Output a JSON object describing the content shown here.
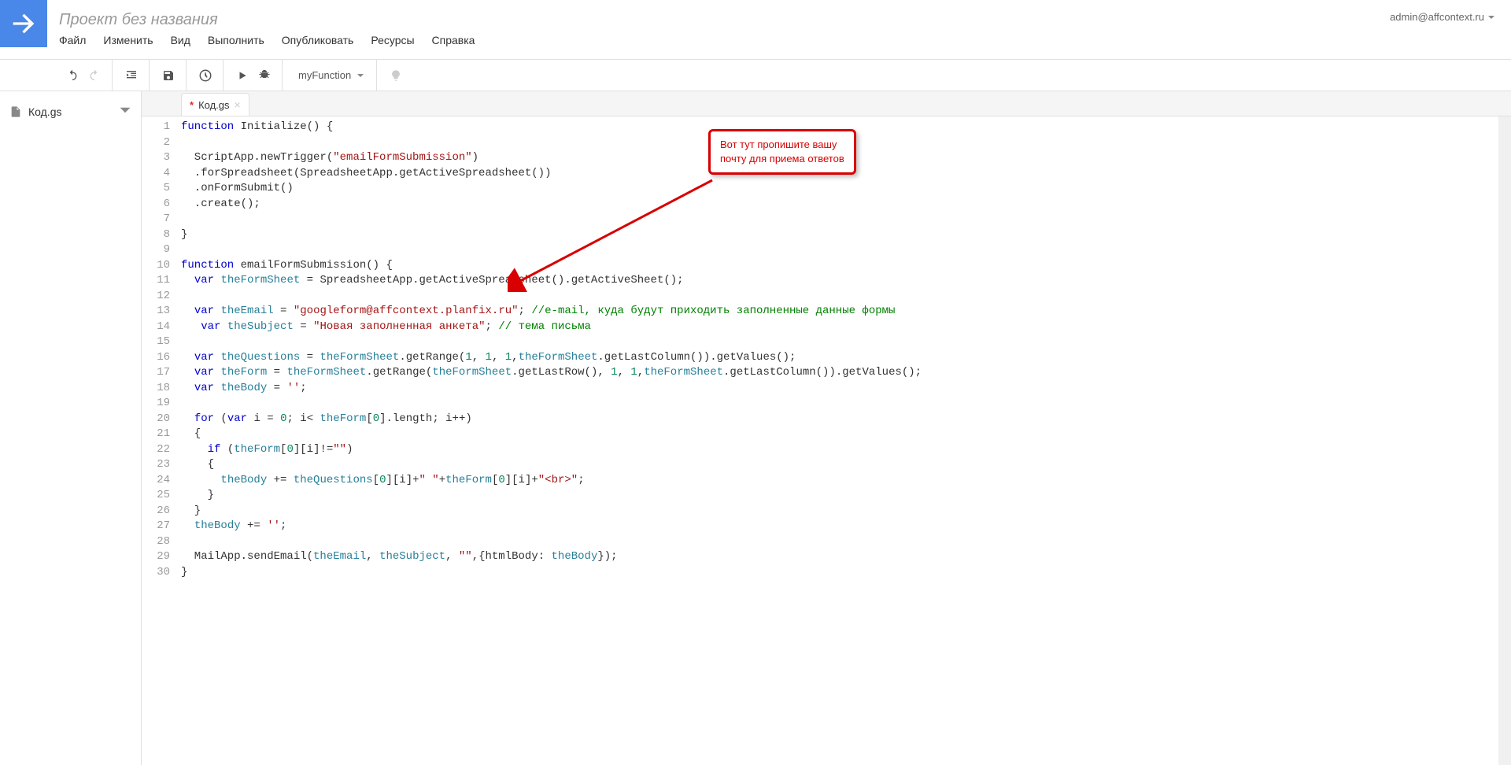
{
  "header": {
    "project_title": "Проект без названия",
    "user_email": "admin@affcontext.ru",
    "menu": [
      "Файл",
      "Изменить",
      "Вид",
      "Выполнить",
      "Опубликовать",
      "Ресурсы",
      "Справка"
    ]
  },
  "toolbar": {
    "function_selected": "myFunction"
  },
  "sidebar": {
    "files": [
      {
        "name": "Код.gs"
      }
    ]
  },
  "tab": {
    "name": "Код.gs",
    "dirty_marker": "*"
  },
  "callout": {
    "line1": "Вот тут пропишите вашу",
    "line2": "почту для приема ответов"
  },
  "code": {
    "lines": [
      [
        {
          "t": "function",
          "c": "kw"
        },
        {
          "t": " Initialize() {"
        }
      ],
      [
        {
          "t": ""
        }
      ],
      [
        {
          "t": "  ScriptApp.newTrigger("
        },
        {
          "t": "\"emailFormSubmission\"",
          "c": "str"
        },
        {
          "t": ")"
        }
      ],
      [
        {
          "t": "  .forSpreadsheet(SpreadsheetApp.getActiveSpreadsheet())"
        }
      ],
      [
        {
          "t": "  .onFormSubmit()"
        }
      ],
      [
        {
          "t": "  .create();"
        }
      ],
      [
        {
          "t": ""
        }
      ],
      [
        {
          "t": "}"
        }
      ],
      [
        {
          "t": ""
        }
      ],
      [
        {
          "t": "function",
          "c": "kw"
        },
        {
          "t": " emailFormSubmission() {"
        }
      ],
      [
        {
          "t": "  "
        },
        {
          "t": "var",
          "c": "kw"
        },
        {
          "t": " "
        },
        {
          "t": "theFormSheet",
          "c": "ident"
        },
        {
          "t": " = SpreadsheetApp.getActiveSpreadsheet().getActiveSheet();"
        }
      ],
      [
        {
          "t": ""
        }
      ],
      [
        {
          "t": "  "
        },
        {
          "t": "var",
          "c": "kw"
        },
        {
          "t": " "
        },
        {
          "t": "theEmail",
          "c": "ident"
        },
        {
          "t": " = "
        },
        {
          "t": "\"googleform@affcontext.planfix.ru\"",
          "c": "str"
        },
        {
          "t": "; "
        },
        {
          "t": "//e-mail, куда будут приходить заполненные данные формы",
          "c": "com"
        }
      ],
      [
        {
          "t": "   "
        },
        {
          "t": "var",
          "c": "kw"
        },
        {
          "t": " "
        },
        {
          "t": "theSubject",
          "c": "ident"
        },
        {
          "t": " = "
        },
        {
          "t": "\"Новая заполненная анкета\"",
          "c": "str"
        },
        {
          "t": "; "
        },
        {
          "t": "// тема письма",
          "c": "com"
        }
      ],
      [
        {
          "t": ""
        }
      ],
      [
        {
          "t": "  "
        },
        {
          "t": "var",
          "c": "kw"
        },
        {
          "t": " "
        },
        {
          "t": "theQuestions",
          "c": "ident"
        },
        {
          "t": " = "
        },
        {
          "t": "theFormSheet",
          "c": "ident"
        },
        {
          "t": ".getRange("
        },
        {
          "t": "1",
          "c": "num"
        },
        {
          "t": ", "
        },
        {
          "t": "1",
          "c": "num"
        },
        {
          "t": ", "
        },
        {
          "t": "1",
          "c": "num"
        },
        {
          "t": ","
        },
        {
          "t": "theFormSheet",
          "c": "ident"
        },
        {
          "t": ".getLastColumn()).getValues();"
        }
      ],
      [
        {
          "t": "  "
        },
        {
          "t": "var",
          "c": "kw"
        },
        {
          "t": " "
        },
        {
          "t": "theForm",
          "c": "ident"
        },
        {
          "t": " = "
        },
        {
          "t": "theFormSheet",
          "c": "ident"
        },
        {
          "t": ".getRange("
        },
        {
          "t": "theFormSheet",
          "c": "ident"
        },
        {
          "t": ".getLastRow(), "
        },
        {
          "t": "1",
          "c": "num"
        },
        {
          "t": ", "
        },
        {
          "t": "1",
          "c": "num"
        },
        {
          "t": ","
        },
        {
          "t": "theFormSheet",
          "c": "ident"
        },
        {
          "t": ".getLastColumn()).getValues();"
        }
      ],
      [
        {
          "t": "  "
        },
        {
          "t": "var",
          "c": "kw"
        },
        {
          "t": " "
        },
        {
          "t": "theBody",
          "c": "ident"
        },
        {
          "t": " = "
        },
        {
          "t": "''",
          "c": "str"
        },
        {
          "t": ";"
        }
      ],
      [
        {
          "t": ""
        }
      ],
      [
        {
          "t": "  "
        },
        {
          "t": "for",
          "c": "kw"
        },
        {
          "t": " ("
        },
        {
          "t": "var",
          "c": "kw"
        },
        {
          "t": " i = "
        },
        {
          "t": "0",
          "c": "num"
        },
        {
          "t": "; i< "
        },
        {
          "t": "theForm",
          "c": "ident"
        },
        {
          "t": "["
        },
        {
          "t": "0",
          "c": "num"
        },
        {
          "t": "].length; i++)"
        }
      ],
      [
        {
          "t": "  {"
        }
      ],
      [
        {
          "t": "    "
        },
        {
          "t": "if",
          "c": "kw"
        },
        {
          "t": " ("
        },
        {
          "t": "theForm",
          "c": "ident"
        },
        {
          "t": "["
        },
        {
          "t": "0",
          "c": "num"
        },
        {
          "t": "][i]!="
        },
        {
          "t": "\"\"",
          "c": "str"
        },
        {
          "t": ")"
        }
      ],
      [
        {
          "t": "    {"
        }
      ],
      [
        {
          "t": "      "
        },
        {
          "t": "theBody",
          "c": "ident"
        },
        {
          "t": " += "
        },
        {
          "t": "theQuestions",
          "c": "ident"
        },
        {
          "t": "["
        },
        {
          "t": "0",
          "c": "num"
        },
        {
          "t": "][i]+"
        },
        {
          "t": "\" \"",
          "c": "str"
        },
        {
          "t": "+"
        },
        {
          "t": "theForm",
          "c": "ident"
        },
        {
          "t": "["
        },
        {
          "t": "0",
          "c": "num"
        },
        {
          "t": "][i]+"
        },
        {
          "t": "\"<br>\"",
          "c": "str"
        },
        {
          "t": ";"
        }
      ],
      [
        {
          "t": "    }"
        }
      ],
      [
        {
          "t": "  }"
        }
      ],
      [
        {
          "t": "  "
        },
        {
          "t": "theBody",
          "c": "ident"
        },
        {
          "t": " += "
        },
        {
          "t": "''",
          "c": "str"
        },
        {
          "t": ";"
        }
      ],
      [
        {
          "t": ""
        }
      ],
      [
        {
          "t": "  MailApp.sendEmail("
        },
        {
          "t": "theEmail",
          "c": "ident"
        },
        {
          "t": ", "
        },
        {
          "t": "theSubject",
          "c": "ident"
        },
        {
          "t": ", "
        },
        {
          "t": "\"\"",
          "c": "str"
        },
        {
          "t": ",{htmlBody: "
        },
        {
          "t": "theBody",
          "c": "ident"
        },
        {
          "t": "});"
        }
      ],
      [
        {
          "t": "}"
        }
      ]
    ]
  }
}
